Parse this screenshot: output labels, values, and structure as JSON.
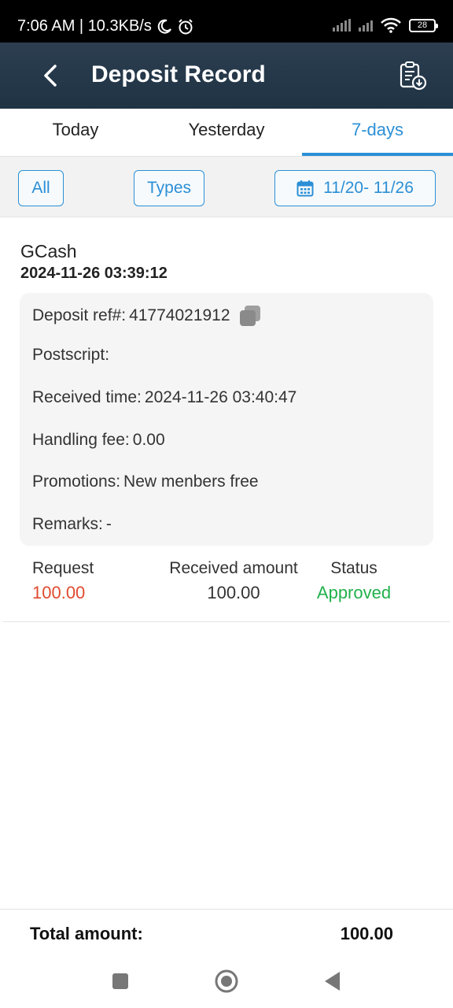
{
  "status_bar": {
    "time_speed": "7:06 AM | 10.3KB/s",
    "battery": "28"
  },
  "header": {
    "title": "Deposit Record"
  },
  "tabs": [
    {
      "label": "Today",
      "active": false
    },
    {
      "label": "Yesterday",
      "active": false
    },
    {
      "label": "7-days",
      "active": true
    }
  ],
  "filters": {
    "all_label": "All",
    "types_label": "Types",
    "date_range": "11/20- 11/26"
  },
  "record": {
    "method": "GCash",
    "datetime": "2024-11-26 03:39:12",
    "details": {
      "ref_label": "Deposit ref#:",
      "ref_value": "41774021912",
      "postscript_label": "Postscript:",
      "postscript_value": "",
      "received_label": "Received time:",
      "received_value": "2024-11-26 03:40:47",
      "fee_label": "Handling fee:",
      "fee_value": "0.00",
      "promo_label": "Promotions:",
      "promo_value": "New menbers free",
      "remarks_label": "Remarks:",
      "remarks_value": "-"
    },
    "summary": {
      "request_label": "Request",
      "request_value": "100.00",
      "received_label": "Received amount",
      "received_value": "100.00",
      "status_label": "Status",
      "status_value": "Approved"
    }
  },
  "footer": {
    "total_label": "Total amount:",
    "total_value": "100.00"
  },
  "colors": {
    "accent": "#2b8fd6",
    "request": "#e04a2f",
    "approved": "#22b14c",
    "header_bg": "#24394b"
  }
}
